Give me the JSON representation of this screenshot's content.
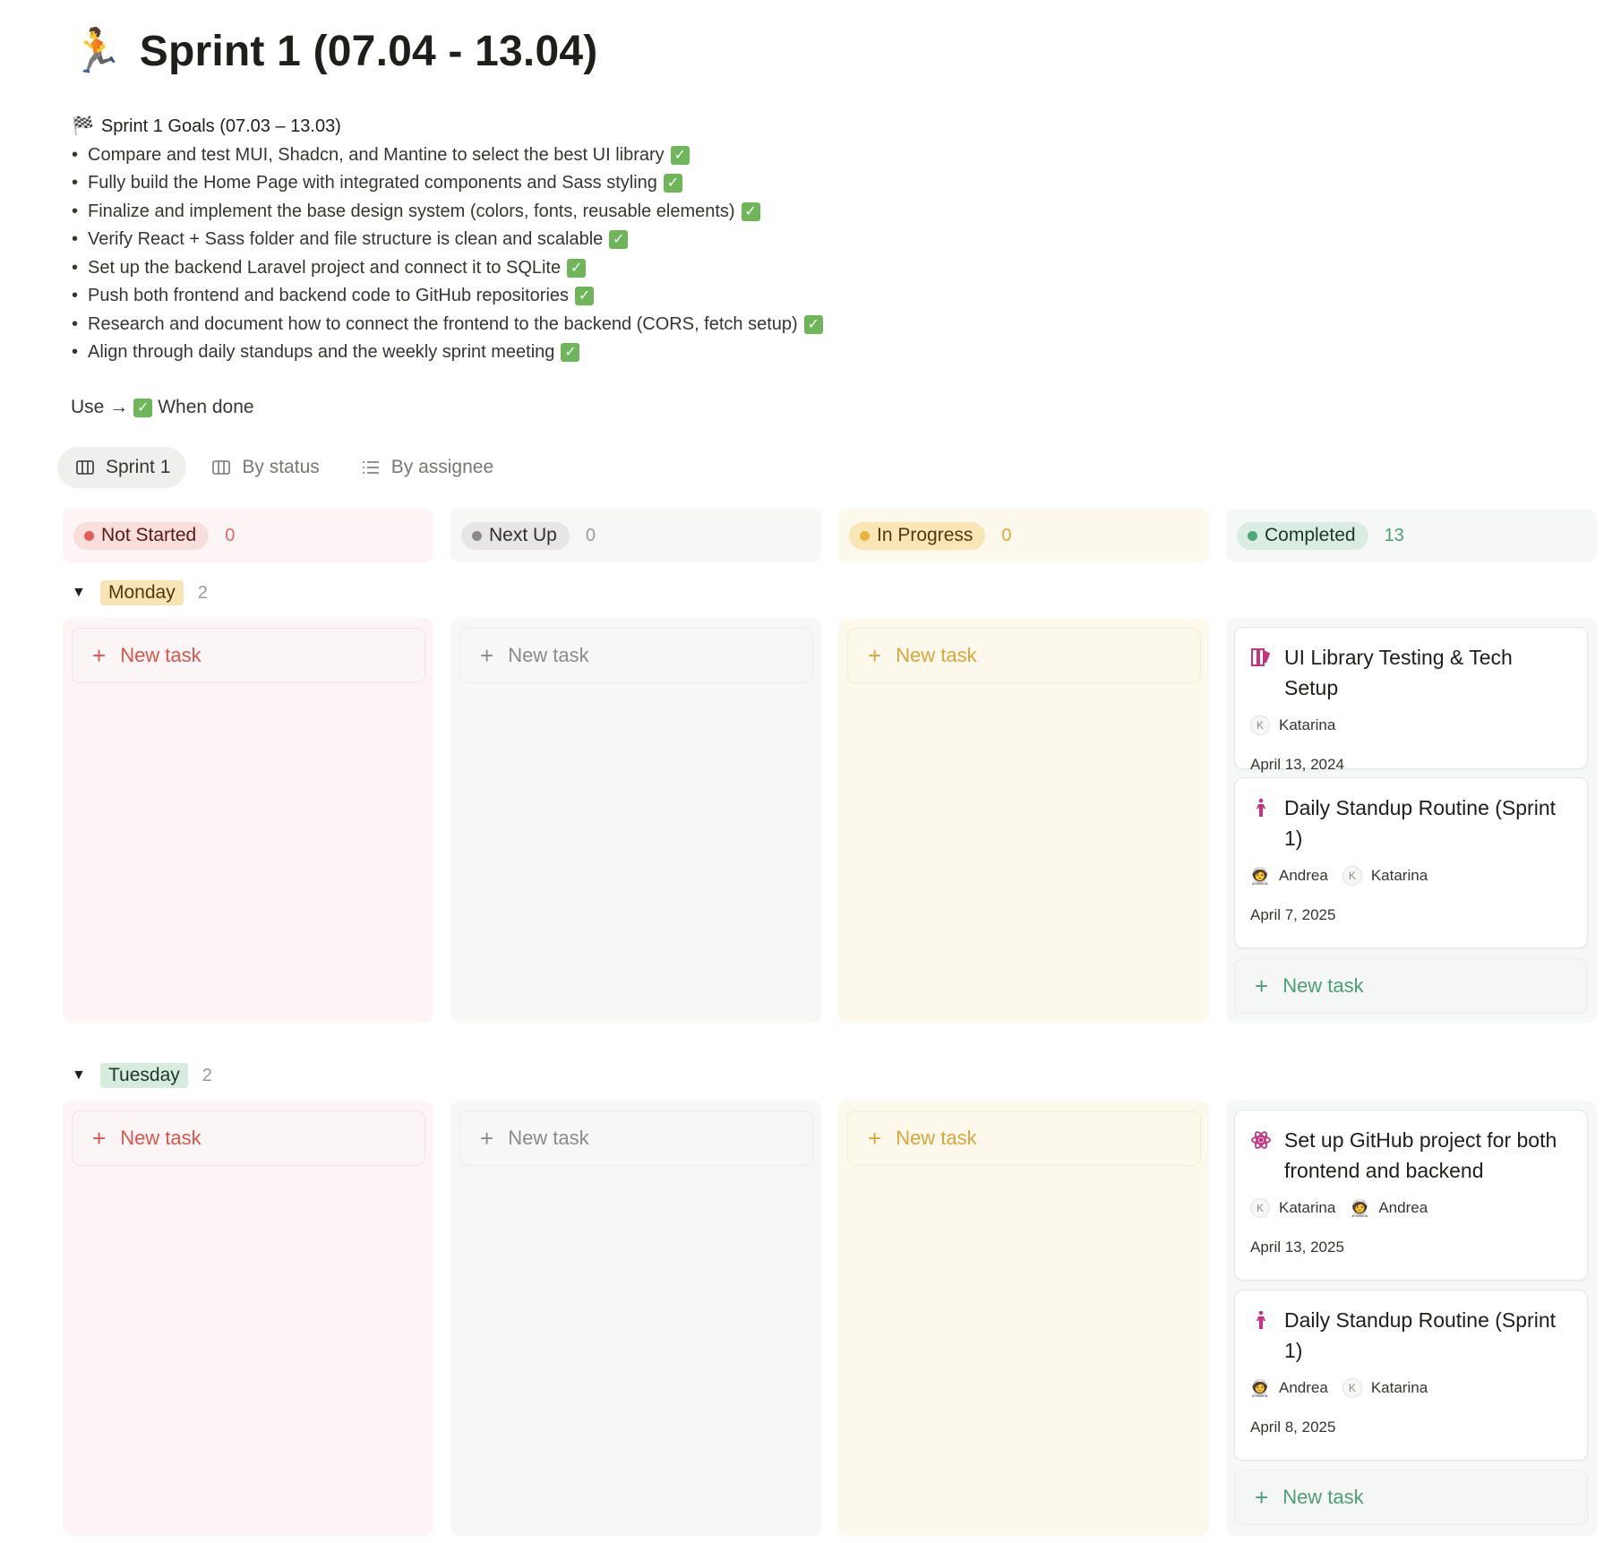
{
  "page": {
    "emoji": "🏃",
    "title": "Sprint 1 (07.04 - 13.04)"
  },
  "goals": {
    "flag": "🏁",
    "heading": "Sprint 1 Goals (07.03 – 13.03)",
    "bullet": "•",
    "check": "✓",
    "items": [
      "Compare and test MUI, Shadcn, and Mantine to select the best UI library",
      "Fully build the Home Page with integrated components and Sass styling",
      "Finalize and implement the base design system (colors, fonts, reusable elements)",
      "Verify React + Sass folder and file structure is clean and scalable",
      "Set up the backend Laravel project and connect it to SQLite",
      "Push both frontend and backend code to GitHub repositories",
      "Research and document how to connect the frontend to the backend (CORS, fetch setup)",
      "Align through daily standups and the weekly sprint meeting"
    ],
    "use_prefix": "Use →",
    "use_suffix": "When done"
  },
  "tabs": [
    {
      "label": "Sprint 1",
      "icon": "board-icon",
      "active": true
    },
    {
      "label": "By status",
      "icon": "board-icon",
      "active": false
    },
    {
      "label": "By assignee",
      "icon": "list-icon",
      "active": false
    }
  ],
  "columns": [
    {
      "label": "Not Started",
      "count": "0",
      "color": "#e25c5a"
    },
    {
      "label": "Next Up",
      "count": "0",
      "color": "#8b8a86"
    },
    {
      "label": "In Progress",
      "count": "0",
      "color": "#e7b33a"
    },
    {
      "label": "Completed",
      "count": "13",
      "color": "#50a77a"
    }
  ],
  "new_task_label": "New task",
  "groups": [
    {
      "label": "Monday",
      "count": "2",
      "cards": [
        {
          "title": "UI Library Testing & Tech Setup",
          "icon": "ui-library-icon",
          "assignees": [
            {
              "initial": "K",
              "name": "Katarina"
            }
          ],
          "date": "April 13, 2024"
        },
        {
          "title": "Daily Standup Routine (Sprint 1)",
          "icon": "standing-person-icon",
          "assignees": [
            {
              "initial": "",
              "name": "Andrea"
            },
            {
              "initial": "K",
              "name": "Katarina"
            }
          ],
          "date": "April 7, 2025"
        }
      ]
    },
    {
      "label": "Tuesday",
      "count": "2",
      "cards": [
        {
          "title": "Set up GitHub project for both frontend and backend",
          "icon": "atom-icon",
          "assignees": [
            {
              "initial": "K",
              "name": "Katarina"
            },
            {
              "initial": "",
              "name": "Andrea"
            }
          ],
          "date": "April 13, 2025"
        },
        {
          "title": "Daily Standup Routine (Sprint 1)",
          "icon": "standing-person-icon",
          "assignees": [
            {
              "initial": "",
              "name": "Andrea"
            },
            {
              "initial": "K",
              "name": "Katarina"
            }
          ],
          "date": "April 8, 2025"
        }
      ]
    }
  ]
}
